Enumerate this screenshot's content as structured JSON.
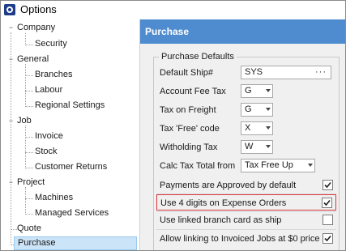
{
  "window": {
    "title": "Options",
    "app_icon": "app-logo-icon"
  },
  "tree": {
    "company": {
      "label": "Company",
      "expander": "−"
    },
    "security": {
      "label": "Security"
    },
    "general": {
      "label": "General",
      "expander": "−"
    },
    "branches": {
      "label": "Branches"
    },
    "labour": {
      "label": "Labour"
    },
    "regional": {
      "label": "Regional Settings"
    },
    "job": {
      "label": "Job",
      "expander": "−"
    },
    "invoice": {
      "label": "Invoice"
    },
    "stock": {
      "label": "Stock"
    },
    "customer_returns": {
      "label": "Customer Returns"
    },
    "project": {
      "label": "Project",
      "expander": "−"
    },
    "machines": {
      "label": "Machines"
    },
    "managed_services": {
      "label": "Managed Services"
    },
    "quote": {
      "label": "Quote"
    },
    "purchase": {
      "label": "Purchase"
    }
  },
  "panel": {
    "header": "Purchase",
    "group_title": "Purchase Defaults",
    "fields": {
      "default_ship": {
        "label": "Default Ship#",
        "value": "SYS",
        "button": "···"
      },
      "account_fee_tax": {
        "label": "Account Fee Tax",
        "value": "G"
      },
      "tax_on_freight": {
        "label": "Tax on Freight",
        "value": "G"
      },
      "tax_free_code": {
        "label": "Tax 'Free' code",
        "value": "X"
      },
      "witholding_tax": {
        "label": "Witholding Tax",
        "value": "W"
      },
      "calc_tax_total": {
        "label": "Calc Tax Total from",
        "value": "Tax Free Up"
      }
    },
    "options": {
      "payments_approved": {
        "label": "Payments are Approved by default",
        "checked": true
      },
      "four_digits": {
        "label": "Use 4 digits on Expense Orders",
        "checked": true
      },
      "linked_branch": {
        "label": "Use linked branch card as ship",
        "checked": false
      },
      "invoiced_jobs": {
        "label": "Allow linking to Invoiced Jobs at $0 price",
        "checked": true
      }
    }
  },
  "colors": {
    "header_bg": "#4e8ccf",
    "selected_bg": "#cce4f7",
    "highlight_border": "#d9363e"
  }
}
